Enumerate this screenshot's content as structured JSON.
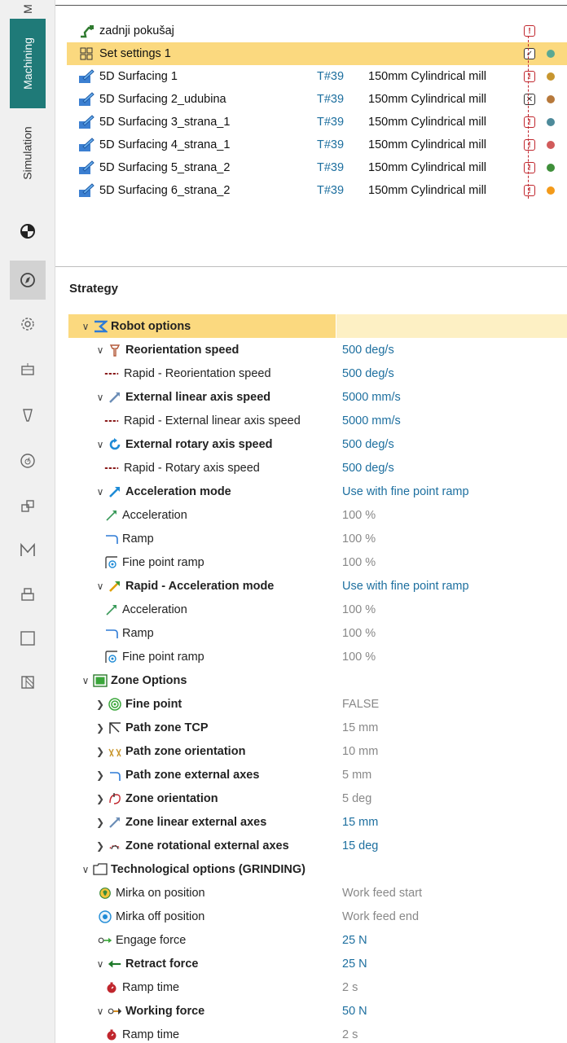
{
  "rail": {
    "tabs": [
      {
        "label": "M"
      },
      {
        "label": "Machining"
      },
      {
        "label": "Simulation"
      }
    ],
    "icons": [
      "pie-icon",
      "compass-icon",
      "gear-icon",
      "frame-icon",
      "tool-icon",
      "clock-dial-icon",
      "cubes-icon",
      "machine-m-icon",
      "printer-icon",
      "square-icon",
      "hatch-icon"
    ]
  },
  "operations": {
    "root": "zadnji pokušaj",
    "settings": "Set settings 1",
    "items": [
      {
        "name": "5D Surfacing 1",
        "tool": "T#39",
        "desc": "150mm Cylindrical mill",
        "status": "!",
        "dot": "#c7962f"
      },
      {
        "name": "5D Surfacing 2_udubina",
        "tool": "T#39",
        "desc": "150mm Cylindrical mill",
        "status": "x",
        "dot": "#b7793b"
      },
      {
        "name": "5D Surfacing 3_strana_1",
        "tool": "T#39",
        "desc": "150mm Cylindrical mill",
        "status": "!",
        "dot": "#4d8a9a"
      },
      {
        "name": "5D Surfacing 4_strana_1",
        "tool": "T#39",
        "desc": "150mm Cylindrical mill",
        "status": "!",
        "dot": "#d15b5b"
      },
      {
        "name": "5D Surfacing 5_strana_2",
        "tool": "T#39",
        "desc": "150mm Cylindrical mill",
        "status": "!",
        "dot": "#3f8f3a"
      },
      {
        "name": "5D Surfacing 6_strana_2",
        "tool": "T#39",
        "desc": "150mm Cylindrical mill",
        "status": "!",
        "dot": "#f39a1a"
      }
    ],
    "settings_dot": "#5aa893"
  },
  "strategy": {
    "title": "Strategy",
    "rows": [
      {
        "label": "Robot options",
        "value": "",
        "bold": true,
        "chev": "v",
        "head": true
      },
      {
        "label": "Reorientation speed",
        "value": "500 deg/s",
        "bold": true,
        "chev": "v",
        "vclass": "blue"
      },
      {
        "label": "Rapid - Reorientation speed",
        "value": "500 deg/s",
        "vclass": "blue"
      },
      {
        "label": "External linear axis speed",
        "value": "5000 mm/s",
        "bold": true,
        "chev": "v",
        "vclass": "blue"
      },
      {
        "label": "Rapid - External linear axis speed",
        "value": "5000 mm/s",
        "vclass": "blue"
      },
      {
        "label": "External rotary axis speed",
        "value": "500 deg/s",
        "bold": true,
        "chev": "v",
        "vclass": "blue"
      },
      {
        "label": "Rapid - Rotary axis speed",
        "value": "500 deg/s",
        "vclass": "blue"
      },
      {
        "label": "Acceleration mode",
        "value": "Use with fine point ramp",
        "bold": true,
        "chev": "v",
        "vclass": "teal"
      },
      {
        "label": "Acceleration",
        "value": "100 %"
      },
      {
        "label": "Ramp",
        "value": "100 %"
      },
      {
        "label": "Fine point ramp",
        "value": "100 %"
      },
      {
        "label": "Rapid - Acceleration mode",
        "value": "Use with fine point ramp",
        "bold": true,
        "chev": "v",
        "vclass": "teal"
      },
      {
        "label": "Acceleration",
        "value": "100 %"
      },
      {
        "label": "Ramp",
        "value": "100 %"
      },
      {
        "label": "Fine point ramp",
        "value": "100 %"
      },
      {
        "label": "Zone Options",
        "value": "",
        "bold": true,
        "chev": "v"
      },
      {
        "label": "Fine point",
        "value": "FALSE",
        "bold": true,
        "chev": ">"
      },
      {
        "label": "Path zone TCP",
        "value": "15 mm",
        "bold": true,
        "chev": ">"
      },
      {
        "label": "Path zone orientation",
        "value": "10 mm",
        "bold": true,
        "chev": ">"
      },
      {
        "label": "Path zone external axes",
        "value": "5 mm",
        "bold": true,
        "chev": ">"
      },
      {
        "label": "Zone orientation",
        "value": "5 deg",
        "bold": true,
        "chev": ">"
      },
      {
        "label": "Zone linear external axes",
        "value": "15 mm",
        "bold": true,
        "chev": ">",
        "vclass": "blue"
      },
      {
        "label": "Zone rotational external axes",
        "value": "15 deg",
        "bold": true,
        "chev": ">",
        "vclass": "blue"
      },
      {
        "label": "Technological options (GRINDING)",
        "value": "",
        "bold": true,
        "chev": "v"
      },
      {
        "label": "Mirka on position",
        "value": "Work feed start"
      },
      {
        "label": "Mirka off position",
        "value": "Work feed end"
      },
      {
        "label": "Engage force",
        "value": "25 N",
        "vclass": "blue"
      },
      {
        "label": "Retract force",
        "value": "25 N",
        "bold": true,
        "chev": "v",
        "vclass": "blue"
      },
      {
        "label": "Ramp time",
        "value": "2 s"
      },
      {
        "label": "Working force",
        "value": "50 N",
        "bold": true,
        "chev": "v",
        "vclass": "blue"
      },
      {
        "label": "Ramp time",
        "value": "2 s"
      }
    ]
  }
}
